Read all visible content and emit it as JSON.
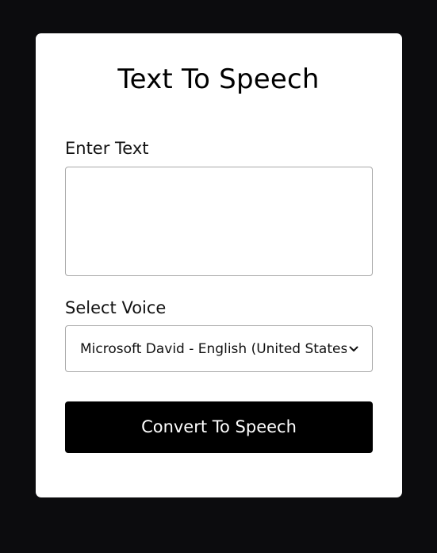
{
  "app": {
    "title": "Text To Speech"
  },
  "form": {
    "text_label": "Enter Text",
    "text_value": "",
    "voice_label": "Select Voice",
    "voice_selected": "Microsoft David - English (United States)",
    "submit_label": "Convert To Speech"
  },
  "icons": {
    "select_arrow": "chevron-down-icon"
  },
  "colors": {
    "page_background": "#0c0c0e",
    "card_background": "#ffffff",
    "button_background": "#000000",
    "button_text": "#ffffff"
  }
}
